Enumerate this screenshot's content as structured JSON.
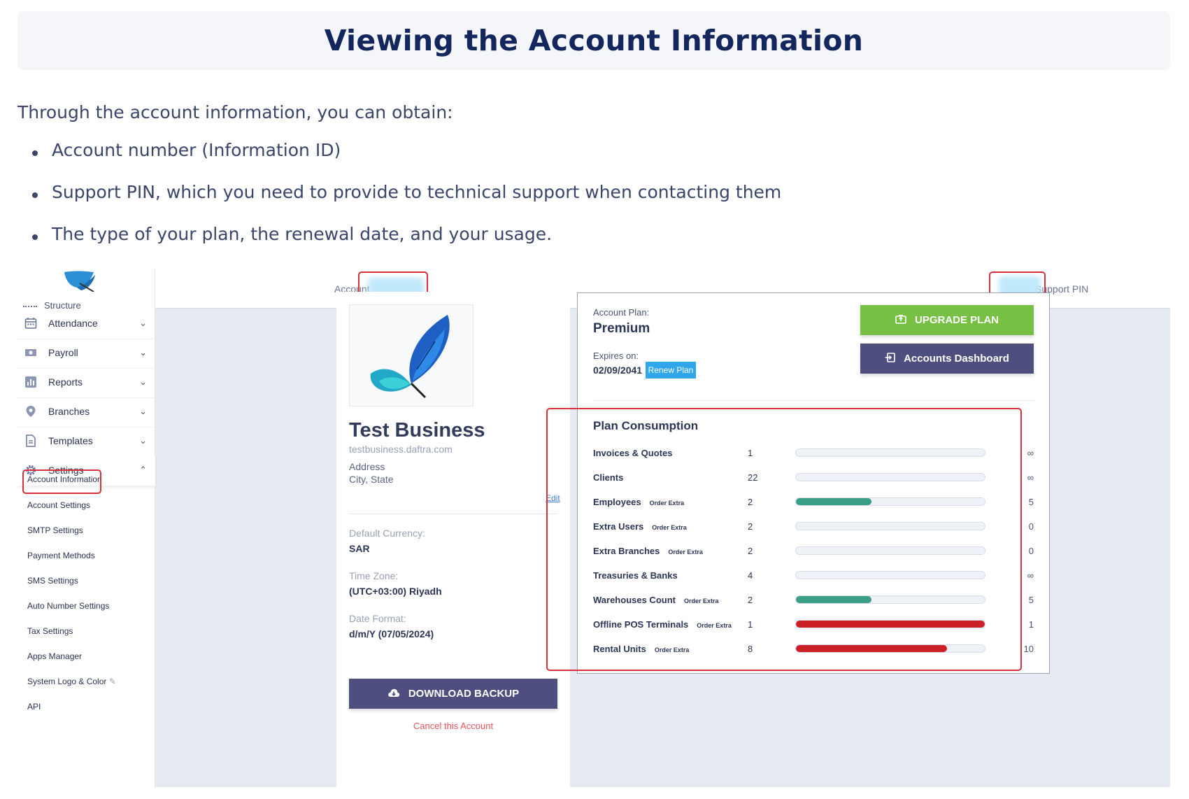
{
  "heading": "Viewing the Account Information",
  "intro": "Through the account information, you can obtain:",
  "bullets": [
    "Account number (Information ID)",
    "Support PIN, which you need to provide to technical support when contacting them",
    "The type of your plan, the renewal date, and your usage."
  ],
  "topbar": {
    "account_label": "Account #",
    "support_pin_label": "Support PIN"
  },
  "sidebar": {
    "partial_item": "Structure",
    "items": [
      {
        "label": "Attendance",
        "icon": "calendar-icon"
      },
      {
        "label": "Payroll",
        "icon": "money-icon"
      },
      {
        "label": "Reports",
        "icon": "bar-chart-icon"
      },
      {
        "label": "Branches",
        "icon": "location-pin-icon"
      },
      {
        "label": "Templates",
        "icon": "document-icon"
      },
      {
        "label": "Settings",
        "icon": "gear-icon"
      }
    ],
    "settings_sub": [
      "Account Information",
      "Account Settings",
      "SMTP Settings",
      "Payment Methods",
      "SMS Settings",
      "Auto Number Settings",
      "Tax Settings",
      "Apps Manager",
      "System Logo & Color",
      "API"
    ]
  },
  "business": {
    "name": "Test Business",
    "url": "testbusiness.daftra.com",
    "address_label": "Address",
    "address_value": "City, State",
    "edit_label": "Edit",
    "currency_label": "Default Currency:",
    "currency_value": "SAR",
    "timezone_label": "Time Zone:",
    "timezone_value": "(UTC+03:00) Riyadh",
    "dateformat_label": "Date Format:",
    "dateformat_value": "d/m/Y (07/05/2024)",
    "download_label": "DOWNLOAD BACKUP",
    "cancel_label": "Cancel this Account"
  },
  "plan": {
    "plan_label": "Account Plan:",
    "plan_value": "Premium",
    "expires_label": "Expires on:",
    "expires_value": "02/09/2041",
    "renew_label": "Renew Plan",
    "upgrade_label": "UPGRADE PLAN",
    "dashboard_label": "Accounts Dashboard",
    "consumption_title": "Plan Consumption",
    "rows": [
      {
        "name": "Invoices & Quotes",
        "extra": "",
        "used": "1",
        "limit": "∞",
        "fraction": 0,
        "color": "#3a9e87"
      },
      {
        "name": "Clients",
        "extra": "",
        "used": "22",
        "limit": "∞",
        "fraction": 0,
        "color": "#3a9e87"
      },
      {
        "name": "Employees",
        "extra": "Order Extra",
        "used": "2",
        "limit": "5",
        "fraction": 0.4,
        "color": "#3a9e87"
      },
      {
        "name": "Extra Users",
        "extra": "Order Extra",
        "used": "2",
        "limit": "0",
        "fraction": 0,
        "color": "#3a9e87"
      },
      {
        "name": "Extra Branches",
        "extra": "Order Extra",
        "used": "2",
        "limit": "0",
        "fraction": 0,
        "color": "#3a9e87"
      },
      {
        "name": "Treasuries & Banks",
        "extra": "",
        "used": "4",
        "limit": "∞",
        "fraction": 0,
        "color": "#3a9e87"
      },
      {
        "name": "Warehouses Count",
        "extra": "Order Extra",
        "used": "2",
        "limit": "5",
        "fraction": 0.4,
        "color": "#3a9e87"
      },
      {
        "name": "Offline POS Terminals",
        "extra": "Order Extra",
        "used": "1",
        "limit": "1",
        "fraction": 1.0,
        "color": "#cc2027"
      },
      {
        "name": "Rental Units",
        "extra": "Order Extra",
        "used": "8",
        "limit": "10",
        "fraction": 0.8,
        "color": "#cc2027"
      }
    ]
  }
}
